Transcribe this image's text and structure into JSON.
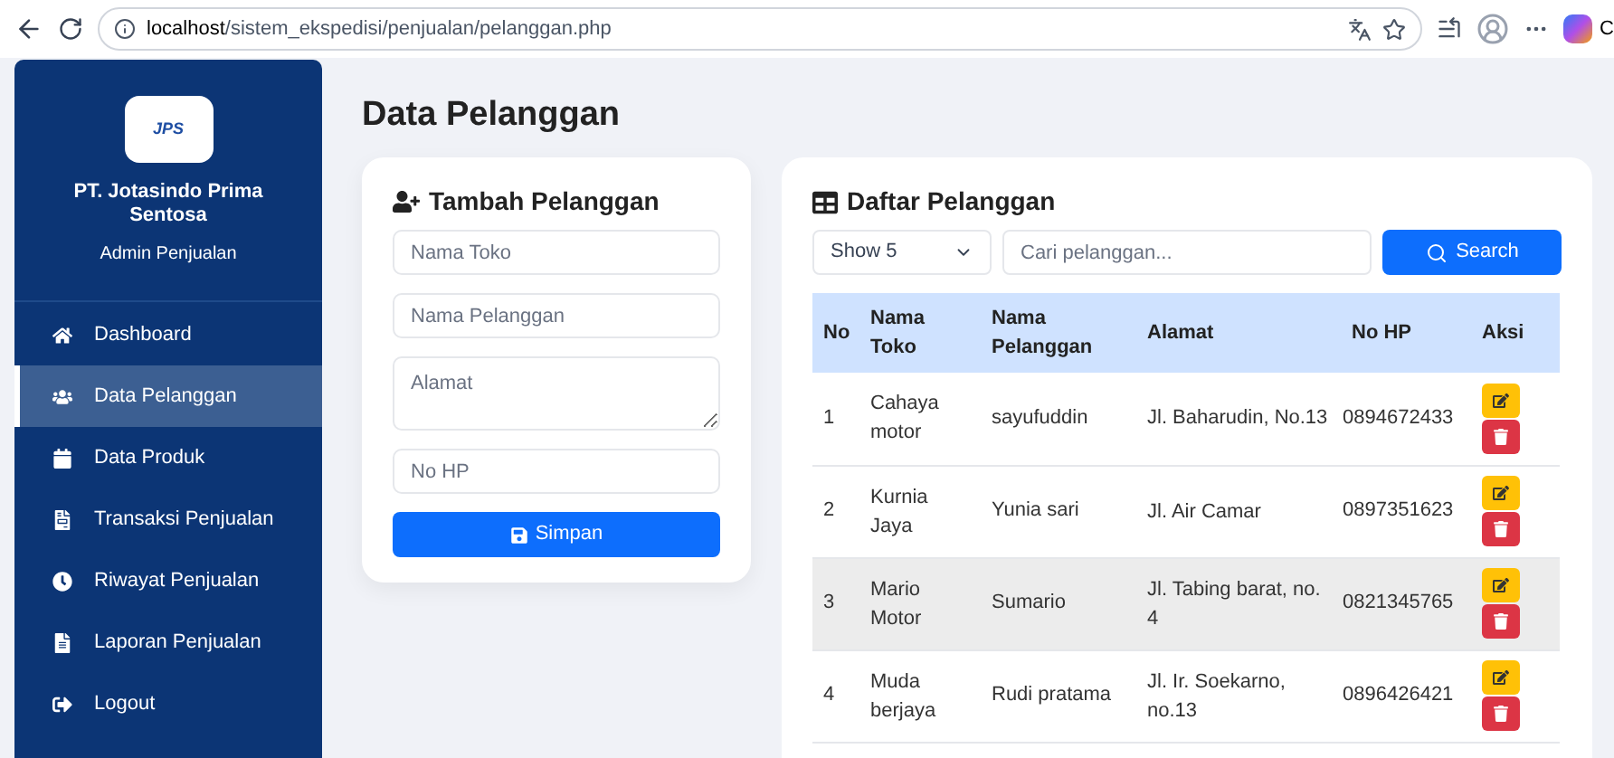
{
  "browser": {
    "url_host": "localhost",
    "url_path": "/sistem_ekspedisi/penjualan/pelanggan.php",
    "profile_label": "C"
  },
  "sidebar": {
    "logo": "JPS",
    "company": "PT. Jotasindo Prima Sentosa",
    "role": "Admin Penjualan",
    "items": [
      {
        "label": "Dashboard",
        "selected": false
      },
      {
        "label": "Data Pelanggan",
        "selected": true
      },
      {
        "label": "Data Produk",
        "selected": false
      },
      {
        "label": "Transaksi Penjualan",
        "selected": false
      },
      {
        "label": "Riwayat Penjualan",
        "selected": false
      },
      {
        "label": "Laporan Penjualan",
        "selected": false
      },
      {
        "label": "Logout",
        "selected": false
      }
    ]
  },
  "page_title": "Data Pelanggan",
  "form": {
    "title": "Tambah Pelanggan",
    "fields": [
      {
        "kind": "input",
        "placeholder": "Nama Toko"
      },
      {
        "kind": "input",
        "placeholder": "Nama Pelanggan"
      },
      {
        "kind": "textarea",
        "placeholder": "Alamat"
      },
      {
        "kind": "input",
        "placeholder": "No HP"
      }
    ],
    "submit": "Simpan"
  },
  "table_card": {
    "title": "Daftar Pelanggan",
    "show_select": "Show 5",
    "search_placeholder": "Cari pelanggan...",
    "search_button": "Search",
    "columns": [
      "No",
      "Nama Toko",
      "Nama Pelanggan",
      "Alamat",
      "No HP",
      "Aksi"
    ],
    "rows": [
      {
        "no": "1",
        "toko": "Cahaya motor",
        "pelanggan": "sayufuddin",
        "alamat": "Jl. Baharudin, No.13",
        "hp": "0894672433",
        "selected": false
      },
      {
        "no": "2",
        "toko": "Kurnia Jaya",
        "pelanggan": "Yunia sari",
        "alamat": "Jl. Air Camar",
        "hp": "0897351623",
        "selected": false
      },
      {
        "no": "3",
        "toko": "Mario Motor",
        "pelanggan": "Sumario",
        "alamat": "Jl. Tabing barat, no. 4",
        "hp": "0821345765",
        "selected": true
      },
      {
        "no": "4",
        "toko": "Muda berjaya",
        "pelanggan": "Rudi pratama",
        "alamat": "Jl. Ir. Soekarno, no.13",
        "hp": "0896426421",
        "selected": false
      }
    ]
  }
}
